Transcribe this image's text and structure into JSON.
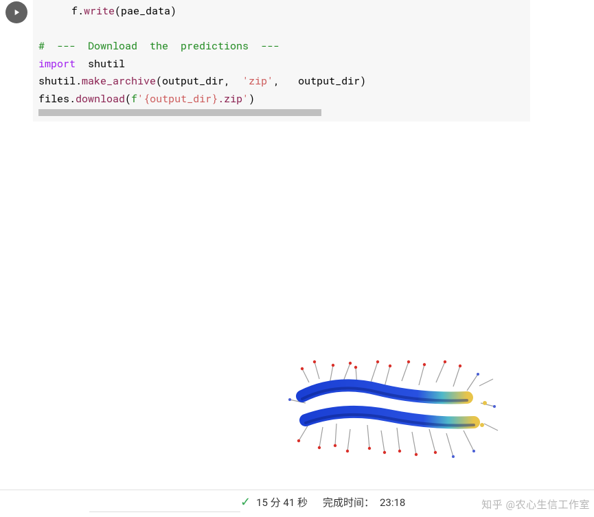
{
  "cell": {
    "lines": {
      "l1_a": "f.",
      "l1_b": "write",
      "l1_c": "(pae_data)",
      "l2": "#  ---  Download  the  predictions  ---",
      "l3_a": "import",
      "l3_b": "  shutil",
      "l4_a": "shutil.",
      "l4_b": "make_archive",
      "l4_c": "(output_dir,  ",
      "l4_d": "'zip'",
      "l4_e": ",   output_dir)",
      "l5_a": "files.",
      "l5_b": "download",
      "l5_c": "(",
      "l5_d": "f",
      "l5_e": "'{output_dir}",
      "l5_f": ".zip",
      "l5_g": "'",
      "l5_h": ")"
    }
  },
  "icons": {
    "run": "play-icon",
    "check": "✓"
  },
  "status": {
    "duration": "15 分 41 秒",
    "completion_label": "完成时间：",
    "completion_time": "23:18"
  },
  "watermark": "知乎 @农心生信工作室"
}
